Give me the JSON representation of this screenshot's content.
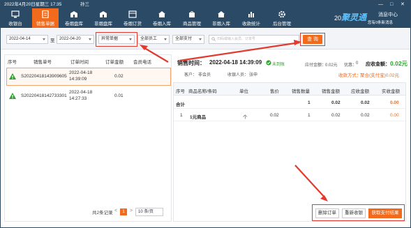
{
  "title_bar": {
    "datetime": "2022年4月20日星期三 17:35",
    "user": "孙三"
  },
  "nav": {
    "items": [
      {
        "label": "收银台",
        "icon": "monitor-icon"
      },
      {
        "label": "销售单据",
        "icon": "receipt-icon",
        "active": true
      },
      {
        "label": "卷烟盘库",
        "icon": "store-icon"
      },
      {
        "label": "非烟盘库",
        "icon": "store-icon"
      },
      {
        "label": "卷烟订货",
        "icon": "cart-icon"
      },
      {
        "label": "卷烟入库",
        "icon": "home-icon"
      },
      {
        "label": "商品管理",
        "icon": "bag-icon"
      },
      {
        "label": "非烟入库",
        "icon": "home-icon"
      },
      {
        "label": "收款统计",
        "icon": "chart-icon"
      },
      {
        "label": "后台管理",
        "icon": "gear-icon"
      }
    ],
    "logo_text": "聚灵通",
    "message_center": "消息中心",
    "shop_number": "您有0条新消息"
  },
  "filters": {
    "date_from": "2022-04-14",
    "to_label": "至",
    "date_to": "2022-04-20",
    "order_type": "异常单据",
    "staff": "全部员工",
    "payment": "全部支付",
    "search_placeholder": "扫码或输入会员、订单号",
    "query_button": "查 询"
  },
  "left_table": {
    "headers": [
      "序号",
      "销售单号",
      "订单时间",
      "订单金额",
      "会员电话"
    ],
    "rows": [
      {
        "order_no": "S20220418143909605",
        "time_date": "2022-04-18",
        "time_clock": "14:39:09",
        "amount": "0.02"
      },
      {
        "order_no": "S20220418142733301",
        "time_date": "2022-04-18",
        "time_clock": "14:27:33",
        "amount": "0.01"
      }
    ],
    "pager_total": "共2条记录",
    "pager_prev": "<",
    "pager_page": "1",
    "pager_next": ">",
    "pager_size": "10 条/页"
  },
  "detail": {
    "sale_time_label": "销售时间：",
    "sale_time": "2022-04-18 14:39:09",
    "status": "未到账",
    "customer_label": "客户：",
    "customer": "非会员",
    "cashier_label": "收银人员：",
    "cashier": "张申",
    "payable_label": "应付金额：",
    "payable": "0.02元",
    "discount_label": "优惠：",
    "discount": "0",
    "received_label": "应收金额：",
    "received": "0.02元",
    "pay_method_label": "收款方式：",
    "pay_method": "聚合(支付宝)0.02元"
  },
  "order_table": {
    "headers": [
      "序号",
      "商品名称/条码",
      "单位",
      "售价",
      "销售数量",
      "销售金额",
      "应收金额",
      "实收金额"
    ],
    "total_row": {
      "label": "合计",
      "qty": "1",
      "sale_amount": "0.02",
      "receivable": "0.02",
      "paid": "0.00"
    },
    "rows": [
      {
        "index": "1",
        "name": "1元商品",
        "unit": "个",
        "price": "0.02",
        "qty": "1",
        "sale_amount": "0.02",
        "receivable": "0.02",
        "paid": "0.00"
      }
    ]
  },
  "actions": {
    "delete": "删除订单",
    "recharge": "重新收银",
    "get_result": "获取支付结果"
  },
  "colors": {
    "nav_bg": "#2b4a66",
    "accent": "#f26a1b",
    "success": "#2aa52a",
    "danger": "#e23a2e"
  }
}
